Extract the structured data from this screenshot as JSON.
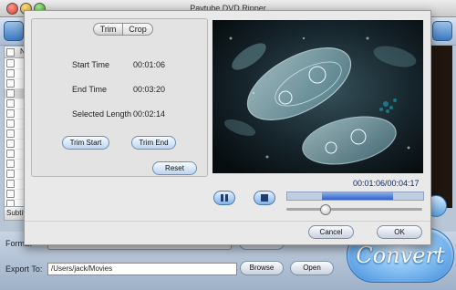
{
  "app": {
    "title": "Pavtube DVD Ripper"
  },
  "file_list": {
    "header": "Na",
    "row_count": 15
  },
  "subtitle": {
    "label": "Subtit"
  },
  "format": {
    "label": "Format"
  },
  "export": {
    "label": "Export To:",
    "path": "/Users/jack/Movies",
    "browse_label": "Browse",
    "open_label": "Open"
  },
  "convert": {
    "label": "Convert"
  },
  "dialog": {
    "tabs": [
      {
        "label": "Trim"
      },
      {
        "label": "Crop"
      }
    ],
    "selected_tab": "Trim",
    "start_time": {
      "label": "Start Time",
      "value": "00:01:06"
    },
    "end_time": {
      "label": "End Time",
      "value": "00:03:20"
    },
    "selected_length": {
      "label": "Selected Length",
      "value": "00:02:14"
    },
    "trim_start_label": "Trim Start",
    "trim_end_label": "Trim End",
    "reset_label": "Reset",
    "time_display": "00:01:06/00:04:17",
    "selection_fraction_start": 0.257,
    "selection_fraction_end": 0.778,
    "volume_fraction": 0.28,
    "cancel_label": "Cancel",
    "ok_label": "OK"
  },
  "icons": {
    "pause": "pause-icon",
    "stop": "stop-icon"
  },
  "colors": {
    "accent": "#2f62c9",
    "convert": "#3f8ad8"
  }
}
